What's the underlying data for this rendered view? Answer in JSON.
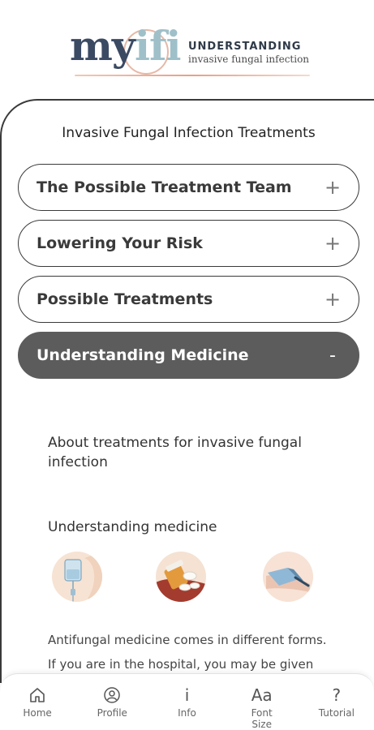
{
  "logo": {
    "word_prefix": "my",
    "word_suffix": "ifi",
    "understanding": "UNDERSTANDING",
    "subtitle": "invasive fungal infection"
  },
  "page": {
    "title": "Invasive Fungal Infection Treatments"
  },
  "accordion": [
    {
      "label": "The Possible Treatment Team",
      "sign": "+",
      "expanded": false
    },
    {
      "label": "Lowering Your Risk",
      "sign": "+",
      "expanded": false
    },
    {
      "label": "Possible Treatments",
      "sign": "+",
      "expanded": false
    },
    {
      "label": "Understanding Medicine",
      "sign": "-",
      "expanded": true
    }
  ],
  "content": {
    "intro": "About treatments for invasive fungal infection",
    "subheading": "Understanding medicine",
    "icons": [
      "iv-bag-icon",
      "pill-bottle-icon",
      "cream-tube-icon"
    ],
    "paragraph_line1": "Antifungal medicine comes in different forms.",
    "paragraph_line2": "If you are in the hospital, you may be given"
  },
  "bottom_nav": [
    {
      "label": "Home",
      "icon": "home-icon"
    },
    {
      "label": "Profile",
      "icon": "profile-icon"
    },
    {
      "label": "Info",
      "icon": "info-icon",
      "glyph": "i"
    },
    {
      "label_line1": "Font",
      "label_line2": "Size",
      "icon": "font-size-icon",
      "glyph": "Aa"
    },
    {
      "label": "Tutorial",
      "icon": "tutorial-icon",
      "glyph": "?"
    }
  ],
  "colors": {
    "active_accordion": "#5c5c5c",
    "logo_navy": "#3b4a63",
    "logo_teal": "#9fc0c9",
    "logo_accent": "#e89f86"
  }
}
